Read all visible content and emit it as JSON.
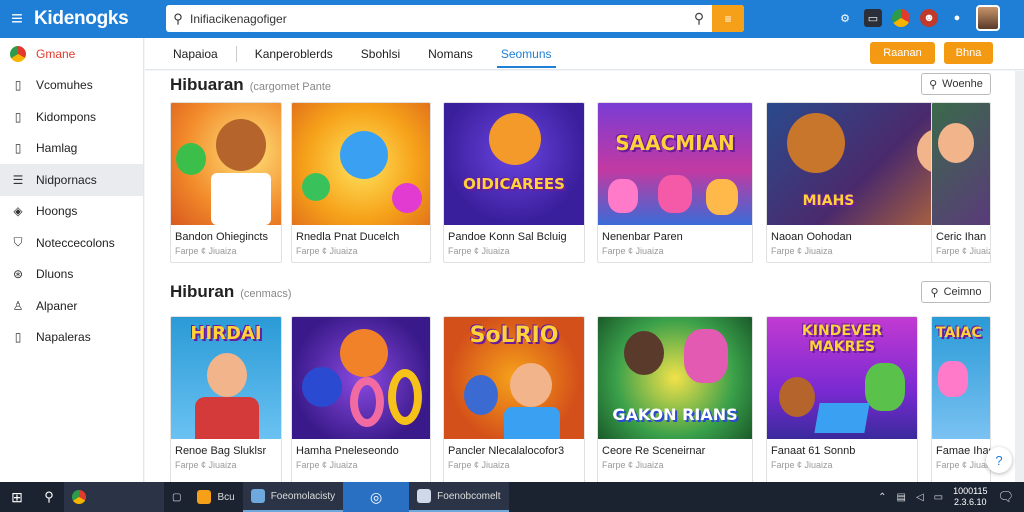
{
  "app": {
    "brand": "Kidenogks"
  },
  "search": {
    "value": "Inifiacikenagofiger",
    "button_icon": "search-icon"
  },
  "top_icons": [
    "settings-icon",
    "monitor-icon",
    "chrome-icon",
    "profile-icon",
    "bell-icon"
  ],
  "sidebar": {
    "items": [
      {
        "label": "Gmane",
        "icon": "google-icon"
      },
      {
        "label": "Vcomuhes",
        "icon": "document-icon"
      },
      {
        "label": "Kidompons",
        "icon": "document-icon"
      },
      {
        "label": "Hamlag",
        "icon": "document-icon"
      },
      {
        "label": "Nidpornacs",
        "icon": "list-icon"
      },
      {
        "label": "Hoongs",
        "icon": "tag-icon"
      },
      {
        "label": "Noteccecolons",
        "icon": "shield-icon"
      },
      {
        "label": "Dluons",
        "icon": "game-icon"
      },
      {
        "label": "Alpaner",
        "icon": "user-icon"
      },
      {
        "label": "Napaleras",
        "icon": "document-icon"
      }
    ]
  },
  "tabs": [
    "Napaioa",
    "Kanperoblerds",
    "Sbohlsi",
    "Nomans",
    "Seomuns"
  ],
  "header_buttons": {
    "primary": "Raanan",
    "secondary": "Bhna"
  },
  "sections": [
    {
      "title": "Hibuaran",
      "subtitle": "(cargomet Pante",
      "button": "Woenhe",
      "cards": [
        {
          "title": "Bandon Ohiegincts",
          "sub": "Farpe ¢ Jiuaiza",
          "art": ""
        },
        {
          "title": "Rnedla Pnat Ducelch",
          "sub": "Farpe ¢ Jiuaiza",
          "art": ""
        },
        {
          "title": "Pandoe Konn Sal Bcluig",
          "sub": "Farpe ¢ Jiuaiza",
          "art": "OIDICAREES"
        },
        {
          "title": "Nenenbar Paren",
          "sub": "Farpe ¢ Jiuaiza",
          "art": "SAACMIAN"
        },
        {
          "title": "Naoan Oohodan",
          "sub": "Farpe ¢ Jiuaiza",
          "art": "MIAHS"
        },
        {
          "title": "Ceric Ihan",
          "sub": "Farpe ¢ Jiuaiza",
          "art": ""
        }
      ]
    },
    {
      "title": "Hiburan",
      "subtitle": "(cenmacs)",
      "button": "Ceimno",
      "cards": [
        {
          "title": "Renoe Bag Sluklsr",
          "sub": "Farpe ¢ Jiuaiza",
          "art": "HIRDAI"
        },
        {
          "title": "Hamha Pneleseondo",
          "sub": "Farpe ¢ Jiuaiza",
          "art": ""
        },
        {
          "title": "Pancler Nlecalalocofor3",
          "sub": "Farpe ¢ Jiuaiza",
          "art": "SoLRIO"
        },
        {
          "title": "Ceore Re Sceneirnar",
          "sub": "Farpe ¢ Jiuaiza",
          "art": "GAKON RIANS"
        },
        {
          "title": "Fanaat 61 Sonnb",
          "sub": "Farpe ¢ Jiuaiza",
          "art": "KINDEVER MAKRES"
        },
        {
          "title": "Famae Ihas",
          "sub": "Farpe ¢ Jiuaiza",
          "art": "TAIAC"
        }
      ]
    }
  ],
  "taskbar": {
    "apps": [
      "Bcu",
      "Foeomolacisty",
      "Foenobcomelt"
    ],
    "clock_time": "1000115",
    "clock_date": "2.3.6.10"
  },
  "colors": {
    "accent": "#1f7fd6",
    "orange": "#f39a12",
    "taskbar": "#1b2331"
  }
}
